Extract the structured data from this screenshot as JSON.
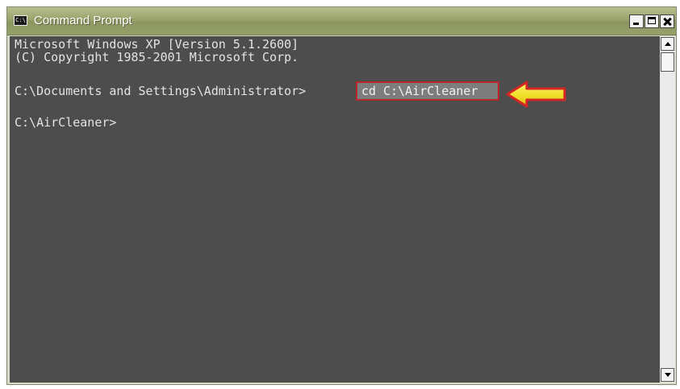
{
  "window": {
    "title": "Command Prompt",
    "icon": "console-icon",
    "icon_label": "C:\\"
  },
  "console": {
    "lines": [
      "Microsoft Windows XP [Version 5.1.2600]",
      "(C) Copyright 1985-2001 Microsoft Corp.",
      "C:\\Documents and Settings\\Administrator>",
      "C:\\AirCleaner>"
    ],
    "highlighted_command": "cd C:\\AirCleaner"
  },
  "colors": {
    "console_background": "#4d4d4d",
    "console_text": "#e3e3e3",
    "highlight_border": "#b6262b",
    "arrow_fill": "#f1df2a"
  },
  "controls": {
    "minimize_icon": "minimize-icon",
    "maximize_icon": "maximize-icon",
    "close_icon": "close-icon",
    "scroll_up_icon": "scroll-up-icon",
    "scroll_down_icon": "scroll-down-icon",
    "annotation_arrow_icon": "yellow-arrow-icon"
  }
}
